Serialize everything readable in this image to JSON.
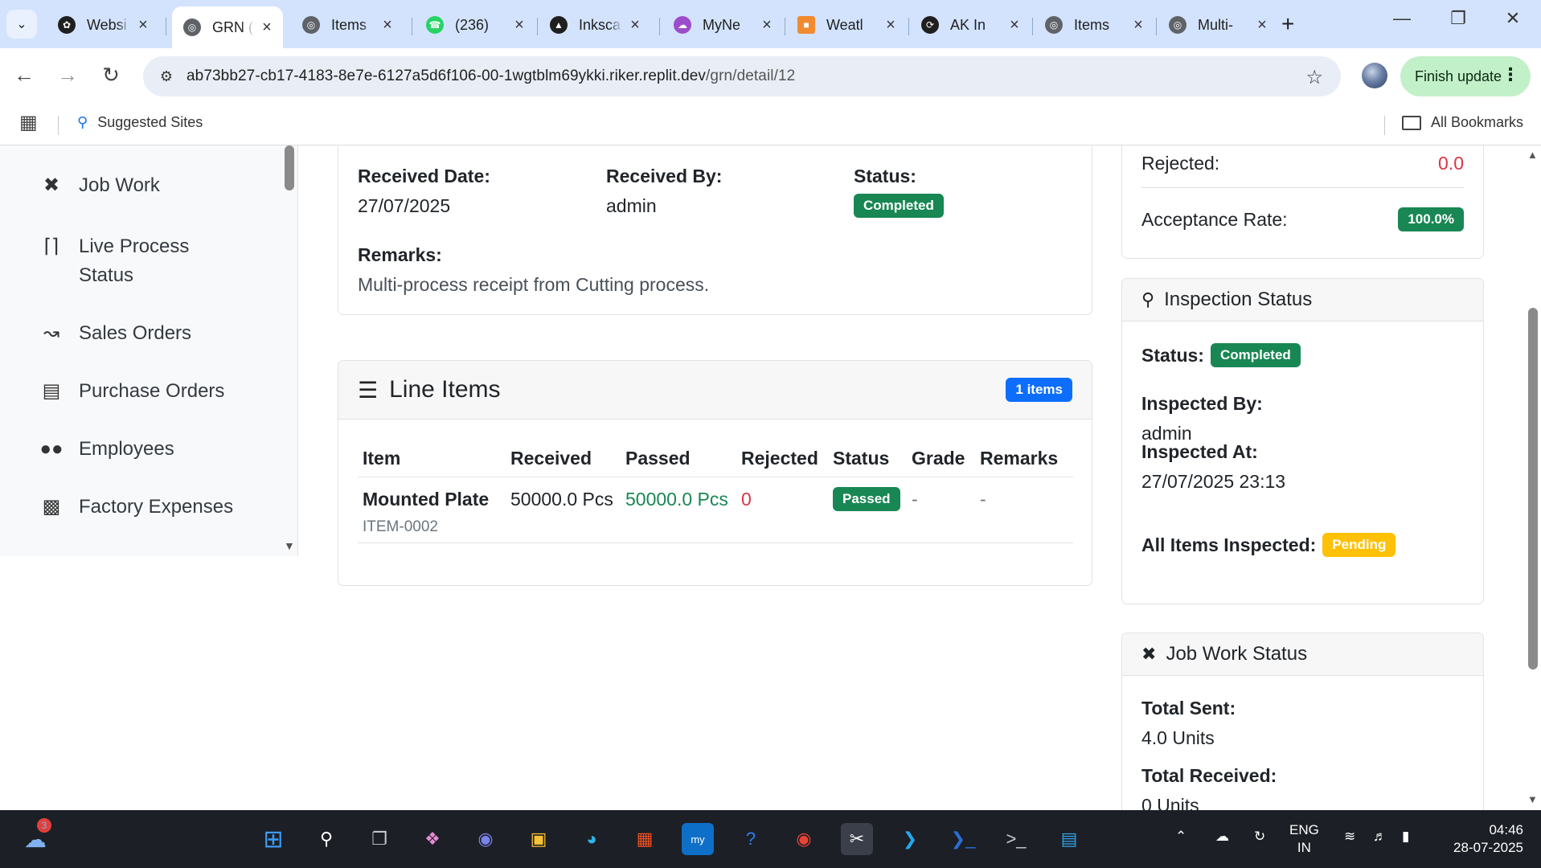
{
  "browser": {
    "tabs": [
      {
        "label": "Websi",
        "icon": "openai-icon",
        "color": "#1f1f1f"
      },
      {
        "label": "GRN (",
        "icon": "globe-icon",
        "color": "#5f6368"
      },
      {
        "label": "Items",
        "icon": "globe-icon",
        "color": "#5f6368"
      },
      {
        "label": "(236)",
        "icon": "whatsapp-icon",
        "color": "#25d366"
      },
      {
        "label": "Inksca",
        "icon": "inkscape-icon",
        "color": "#1f1f1f"
      },
      {
        "label": "MyNe",
        "icon": "cloud-icon",
        "color": "#9c4dcc"
      },
      {
        "label": "Weatl",
        "icon": "weather-icon",
        "color": "#f28b30"
      },
      {
        "label": "AK In",
        "icon": "replit-icon",
        "color": "#1f1f1f"
      },
      {
        "label": "Items",
        "icon": "globe-icon",
        "color": "#5f6368"
      },
      {
        "label": "Multi-",
        "icon": "globe-icon",
        "color": "#5f6368"
      }
    ],
    "url_host": "ab73bb27-cb17-4183-8e7e-6127a5d6f106-00-1wgtblm69ykki.riker.replit.dev",
    "url_path": "/grn/detail/12",
    "update_label": "Finish update",
    "suggested_sites": "Suggested Sites",
    "all_bookmarks": "All Bookmarks"
  },
  "sidebar": {
    "items": [
      {
        "label": "Job Work",
        "icon": "tools-icon"
      },
      {
        "label": "Live Process Status",
        "icon": "broadcast-icon"
      },
      {
        "label": "Sales Orders",
        "icon": "chart-line-icon"
      },
      {
        "label": "Purchase Orders",
        "icon": "document-icon"
      },
      {
        "label": "Employees",
        "icon": "people-icon"
      },
      {
        "label": "Factory Expenses",
        "icon": "receipt-icon"
      }
    ]
  },
  "receipt": {
    "received_date_label": "Received Date:",
    "received_date": "27/07/2025",
    "received_by_label": "Received By:",
    "received_by": "admin",
    "status_label": "Status:",
    "status": "Completed",
    "remarks_label": "Remarks:",
    "remarks": "Multi-process receipt from Cutting process."
  },
  "line_items": {
    "title": "Line Items",
    "count_badge": "1 items",
    "headers": [
      "Item",
      "Received",
      "Passed",
      "Rejected",
      "Status",
      "Grade",
      "Remarks"
    ],
    "rows": [
      {
        "item": "Mounted Plate",
        "code": "ITEM-0002",
        "received": "50000.0 Pcs",
        "passed": "50000.0 Pcs",
        "rejected": "0",
        "status": "Passed",
        "grade": "-",
        "remarks": "-"
      }
    ]
  },
  "summary": {
    "rejected_label": "Rejected:",
    "rejected": "0.0",
    "acceptance_label": "Acceptance Rate:",
    "acceptance": "100.0%"
  },
  "inspection": {
    "title": "Inspection Status",
    "status_label": "Status:",
    "status": "Completed",
    "inspected_by_label": "Inspected By:",
    "inspected_by": "admin",
    "inspected_at_label": "Inspected At:",
    "inspected_at": "27/07/2025 23:13",
    "all_items_label": "All Items Inspected:",
    "all_items": "Pending"
  },
  "job_work": {
    "title": "Job Work Status",
    "total_sent_label": "Total Sent:",
    "total_sent": "4.0 Units",
    "total_received_label": "Total Received:",
    "total_received": "0 Units"
  },
  "taskbar": {
    "weather_badge": "3",
    "lang_line1": "ENG",
    "lang_line2": "IN",
    "time": "04:46",
    "date": "28-07-2025"
  },
  "colors": {
    "success": "#198754",
    "primary": "#0d6efd",
    "warning": "#ffc107",
    "danger": "#dc3545",
    "passed_text": "#198754",
    "chrome_bg": "#d3e3fd"
  }
}
